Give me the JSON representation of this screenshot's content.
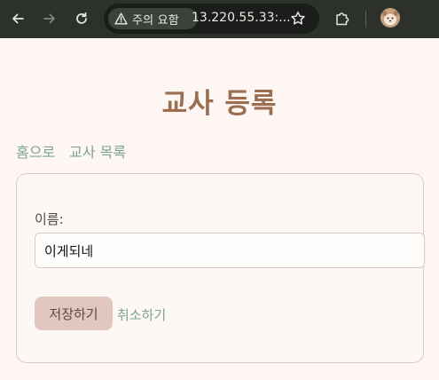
{
  "browser": {
    "security_chip": "주의 요함",
    "url": "13.220.55.33:...",
    "icons": [
      "back-icon",
      "forward-icon",
      "reload-icon",
      "warning-icon",
      "star-icon",
      "extensions-icon",
      "profile-avatar"
    ]
  },
  "page": {
    "title": "교사 등록",
    "nav": {
      "home": "홈으로",
      "teacher_list": "교사 목록"
    },
    "form": {
      "name_label": "이름:",
      "name_value": "이게되네",
      "save_label": "저장하기",
      "cancel_label": "취소하기"
    }
  },
  "colors": {
    "background": "#fdf6f3",
    "title": "#9b6e52",
    "link": "#7ba494",
    "button": "#e2c7c0",
    "toolbar": "#2c312b"
  }
}
